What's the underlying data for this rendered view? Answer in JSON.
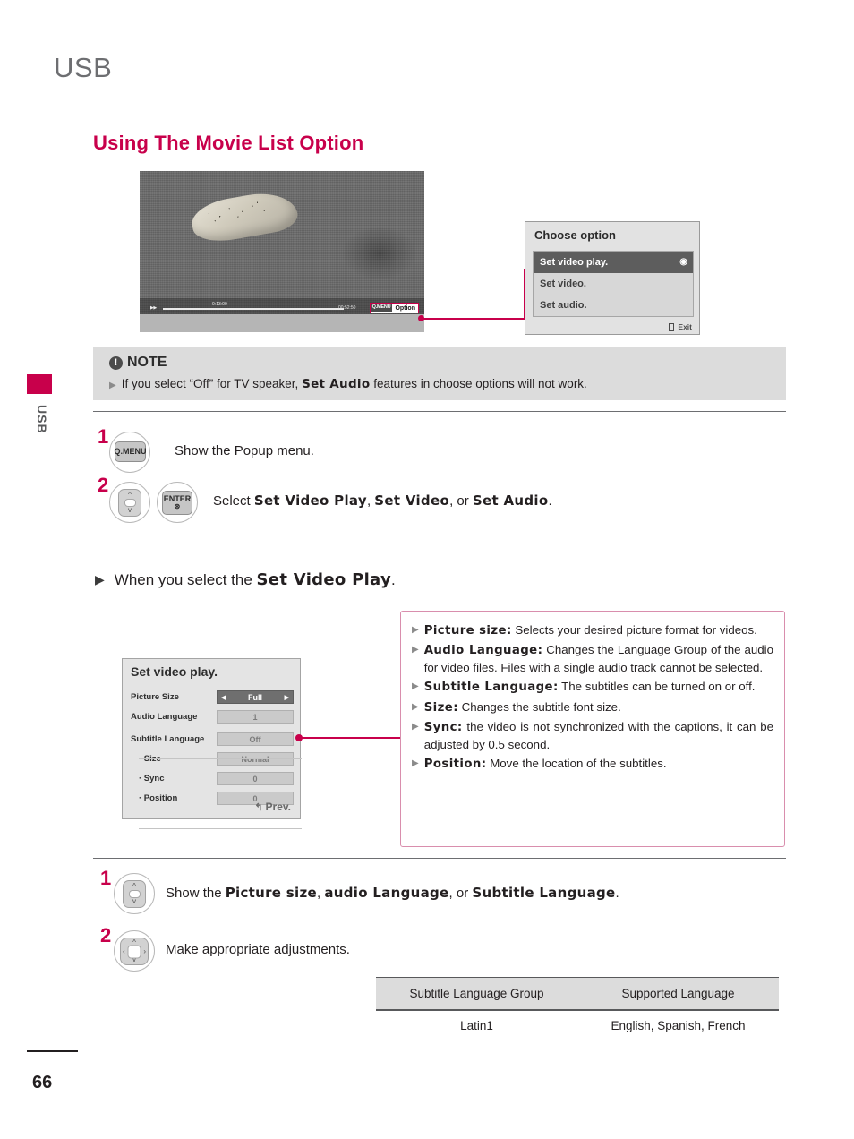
{
  "colors": {
    "accent": "#c8004b",
    "title_gray": "#6d6e71",
    "note_bg": "#dcdcdc"
  },
  "edge_tab": {
    "label": "USB"
  },
  "header": {
    "page_title": "USB",
    "section_title": "Using The Movie List Option"
  },
  "tv_screenshot": {
    "alt": "movie playback of a grayscale photo of fruit",
    "playbar": {
      "ff_icon": "▶▶",
      "current_time": "- 0:13:00",
      "duration": "00:52:50"
    },
    "qmenu_hint": {
      "key": "Q.MENU",
      "label": "Option"
    }
  },
  "choose_option_dialog": {
    "title": "Choose option",
    "items": [
      {
        "label": "Set video play.",
        "selected": true,
        "radio": "◉"
      },
      {
        "label": "Set video.",
        "selected": false
      },
      {
        "label": "Set audio.",
        "selected": false
      }
    ],
    "footer": {
      "exit_label": "Exit"
    }
  },
  "note": {
    "heading": "NOTE",
    "bang": "!",
    "bullet": "▶",
    "text_before": "If you select “Off” for TV speaker,",
    "emphasis": "Set Audio",
    "text_after": "features in choose options will not work."
  },
  "steps_top": [
    {
      "number": "1",
      "key": "Q.MENU",
      "text": "Show the Popup menu."
    },
    {
      "number": "2",
      "key_nav": "nav-up-down",
      "key2_line1": "ENTER",
      "key2_line2": "⊛",
      "text_parts": [
        "Select ",
        "Set Video Play",
        ", ",
        "Set Video",
        ", or ",
        "Set Audio",
        "."
      ]
    }
  ],
  "when_you_select": {
    "bullet": "▶",
    "text_before": "When you select the",
    "emphasis": "Set Video Play",
    "text_after": "."
  },
  "osd_panel": {
    "title": "Set video play.",
    "rows": [
      {
        "label": "Picture Size",
        "value": "Full",
        "active": true,
        "left_arrow": "◀",
        "right_arrow": "▶"
      },
      {
        "label": "Audio Language",
        "value": "1",
        "active": false
      },
      {
        "label": "Subtitle Language",
        "value": "Off",
        "active": false
      },
      {
        "label": "·  Size",
        "value": "Normal",
        "active": false,
        "sub": true
      },
      {
        "label": "·  Sync",
        "value": "0",
        "active": false,
        "sub": true
      },
      {
        "label": "·  Position",
        "value": "0",
        "active": false,
        "sub": true
      }
    ],
    "prev_label": "Prev.",
    "prev_icon": "↰"
  },
  "description": {
    "items": [
      {
        "term": "Picture size:",
        "text": "Selects your desired picture format for videos."
      },
      {
        "term": "Audio Language:",
        "text": "Changes the Language Group of the audio for video files. Files with a single audio track cannot be selected."
      },
      {
        "term": "Subtitle Language:",
        "text": "The subtitles can be turned on or off."
      },
      {
        "term": "Size:",
        "text": "Changes the subtitle font size."
      },
      {
        "term": "Sync:",
        "text": "the video is not synchronized with the captions, it can be adjusted by 0.5 second."
      },
      {
        "term": "Position:",
        "text": "Move the location of the subtitles."
      }
    ]
  },
  "steps_bottom": [
    {
      "number": "1",
      "key_nav": "nav-up-down",
      "text_parts": [
        "Show the ",
        "Picture size",
        ", ",
        "audio Language",
        ", or ",
        "Subtitle Language",
        "."
      ]
    },
    {
      "number": "2",
      "key_nav": "nav-four-way",
      "text": "Make appropriate adjustments."
    }
  ],
  "table": {
    "headers": [
      "Subtitle Language Group",
      "Supported Language"
    ],
    "rows": [
      [
        "Latin1",
        "English, Spanish, French"
      ]
    ]
  },
  "footer": {
    "page_number": "66"
  }
}
